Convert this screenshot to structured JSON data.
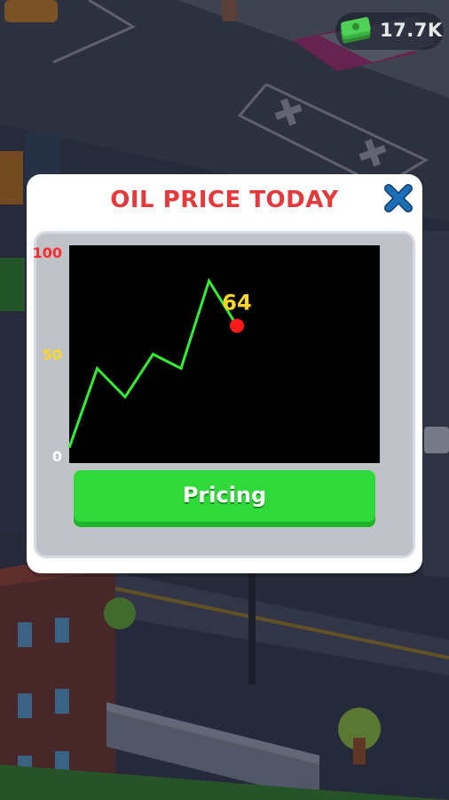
{
  "hud": {
    "cash_amount": "17.7K",
    "cash_icon": "cash-stack-icon"
  },
  "modal": {
    "title": "OIL PRICE TODAY",
    "close_icon": "close-x-icon",
    "pricing_button_label": "Pricing"
  },
  "colors": {
    "title_red": "#e5393b",
    "close_blue": "#1c6fb5",
    "line_green": "#33ee33",
    "marker_red": "#ff1a1a",
    "label_yellow": "#ffd52a",
    "tick_red": "#ff2a2a",
    "button_green": "#2fd93a"
  },
  "chart_data": {
    "type": "line",
    "title": "",
    "xlabel": "",
    "ylabel": "",
    "ylim": [
      0,
      100
    ],
    "y_ticks": [
      "0",
      "50",
      "100"
    ],
    "grid": false,
    "series": [
      {
        "x": [
          0,
          1,
          2,
          3,
          4,
          5,
          6
        ],
        "values": [
          4,
          43,
          29,
          50,
          43,
          86,
          64
        ]
      }
    ],
    "current_value_label": "64"
  }
}
